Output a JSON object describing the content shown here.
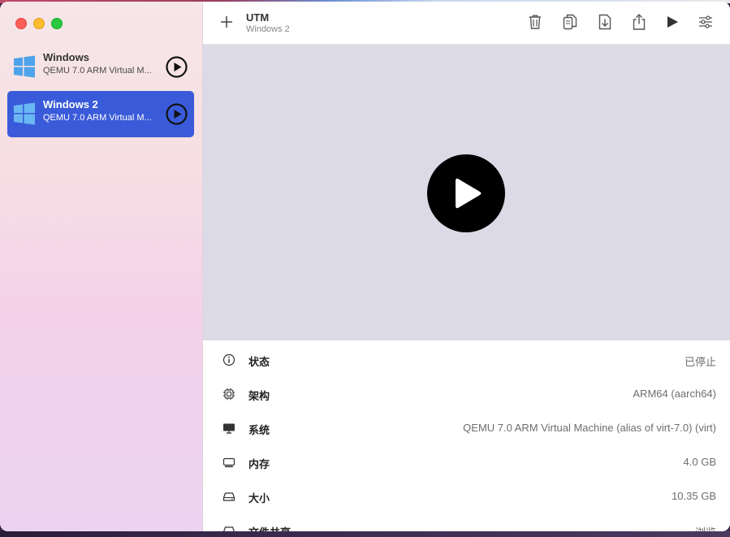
{
  "sidebar": {
    "vms": [
      {
        "name": "Windows",
        "description": "QEMU 7.0 ARM Virtual M..."
      },
      {
        "name": "Windows 2",
        "description": "QEMU 7.0 ARM Virtual M..."
      }
    ],
    "selected_index": 1,
    "accent_color": "#3a5bd9"
  },
  "toolbar": {
    "title": "UTM",
    "subtitle": "Windows 2",
    "icons": [
      "add-icon",
      "trash-icon",
      "clone-icon",
      "download-icon",
      "share-icon",
      "play-icon",
      "settings-sliders-icon"
    ]
  },
  "details": [
    {
      "icon": "info-icon",
      "label": "状态",
      "value": "已停止"
    },
    {
      "icon": "cpu-chip-icon",
      "label": "架构",
      "value": "ARM64 (aarch64)"
    },
    {
      "icon": "display-icon",
      "label": "系统",
      "value": "QEMU 7.0 ARM Virtual Machine (alias of virt-7.0) (virt)"
    },
    {
      "icon": "memory-icon",
      "label": "内存",
      "value": "4.0 GB"
    },
    {
      "icon": "drive-icon",
      "label": "大小",
      "value": "10.35 GB"
    },
    {
      "icon": "shared-drive-icon",
      "label": "文件共享",
      "value": "浏览"
    }
  ]
}
